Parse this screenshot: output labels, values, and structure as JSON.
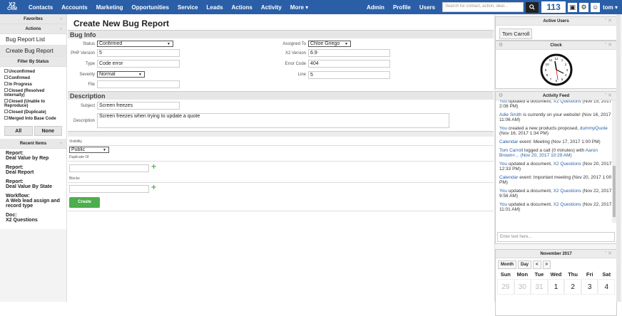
{
  "brand": {
    "logo_top": "X2",
    "logo_bottom": "CRM"
  },
  "nav": {
    "items": [
      "Contacts",
      "Accounts",
      "Marketing",
      "Opportunities",
      "Service",
      "Leads",
      "Actions",
      "Activity",
      "More ▾"
    ],
    "right_items": [
      "Admin",
      "Profile",
      "Users"
    ],
    "search_placeholder": "Search for contact, action, deal...",
    "notifications": "113",
    "user": "tom ▾"
  },
  "sidebar": {
    "favorites": "Favorites",
    "actions": "Actions",
    "items": [
      "Bug Report List",
      "Create Bug Report"
    ],
    "filter_title": "Filter By Status",
    "filters": [
      "Unconfirmed",
      "Confirmed",
      "In Progress",
      "Closed (Resolved Internally)",
      "Closed (Unable to Reproduce)",
      "Closed (Duplicate)",
      "Merged Into Base Code"
    ],
    "all": "All",
    "none": "None",
    "recent_title": "Recent Items",
    "recent": [
      {
        "type": "Report:",
        "name": "Deal Value by Rep"
      },
      {
        "type": "Report:",
        "name": "Deal Report"
      },
      {
        "type": "Report:",
        "name": "Deal Value By State"
      },
      {
        "type": "Workflow:",
        "name": "A Web lead assign and record type"
      },
      {
        "type": "Doc:",
        "name": "X2 Questions"
      }
    ]
  },
  "main": {
    "title": "Create New Bug Report",
    "bug_info": "Bug Info",
    "status_label": "Status",
    "status": "Confirmed",
    "php_label": "PHP Version",
    "php": "5",
    "type_label": "Type",
    "type": "Code error",
    "severity_label": "Severity",
    "severity": "Normal",
    "file_label": "File",
    "file": "",
    "assigned_label": "Assigned To",
    "assigned": "Chloe Griego",
    "x2ver_label": "X2 Version",
    "x2ver": "6.9",
    "errcode_label": "Error Code",
    "errcode": "404",
    "line_label": "Line",
    "line": "5",
    "description": "Description",
    "subject_label": "Subject",
    "subject": "Screen freezes",
    "desc_label": "Description",
    "desc": "Screen freezes when trying to update a quote",
    "visibility_label": "Visibility",
    "visibility": "Public",
    "duplicate_label": "Duplicate Of",
    "blocks_label": "Blocks",
    "create": "Create"
  },
  "right": {
    "active_users": "Active Users",
    "active_user": "Tom Carroll",
    "clock": "Clock",
    "activity_feed": "Activity Feed",
    "feed_input": "Enter text here...",
    "calendar_title": "November 2017",
    "cal_month": "Month",
    "cal_day": "Day",
    "cal_prev": "<",
    "cal_next": ">",
    "cal_days": [
      "Sun",
      "Mon",
      "Tue",
      "Wed",
      "Thu",
      "Fri",
      "Sat"
    ],
    "cal_dates": [
      "29",
      "30",
      "31",
      "1",
      "2",
      "3",
      "4"
    ]
  }
}
